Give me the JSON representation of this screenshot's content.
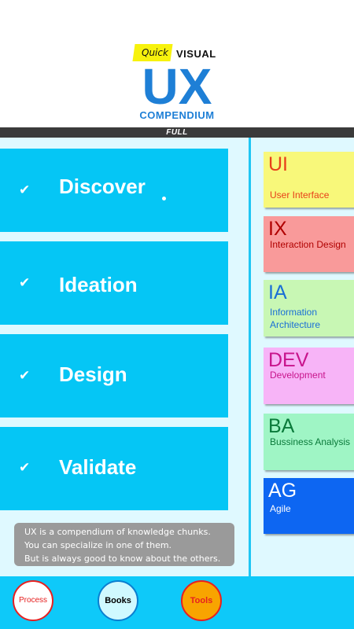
{
  "header": {
    "quick_label": "Quick",
    "visual_label": "VISUAL",
    "ux_label": "UX",
    "compendium_label": "COMPENDIUM",
    "full_label": "FULL"
  },
  "phases": [
    {
      "label": "Discover",
      "check": "✔"
    },
    {
      "label": "Ideation",
      "check": "✔"
    },
    {
      "label": "Design",
      "check": "✔"
    },
    {
      "label": "Validate",
      "check": "✔"
    }
  ],
  "info_text": {
    "line1": "UX is a compendium of knowledge chunks.",
    "line2": "You can specialize in one of them.",
    "line3": "But is always good to know about the others."
  },
  "topics": [
    {
      "abbr": "UI",
      "title": "User Interface",
      "bg": "#f8f87a",
      "color": "#e8401a"
    },
    {
      "abbr": "IX",
      "title": "Interaction Design",
      "bg": "#f99a9a",
      "color": "#b00000"
    },
    {
      "abbr": "IA",
      "title": "Information",
      "title2": "Architecture",
      "bg": "#c8f7b4",
      "color": "#1a6fd6"
    },
    {
      "abbr": "DEV",
      "title": "Development",
      "bg": "#f7b4f7",
      "color": "#c8148c"
    },
    {
      "abbr": "BA",
      "title": "Bussiness Analysis",
      "bg": "#9ff5c5",
      "color": "#0a7a3a"
    },
    {
      "abbr": "AG",
      "title": "Agile",
      "bg": "#0d66f2",
      "color": "#ffffff"
    }
  ],
  "bottom_nav": {
    "process_label": "Process",
    "books_label": "Books",
    "tools_label": "Tools"
  }
}
